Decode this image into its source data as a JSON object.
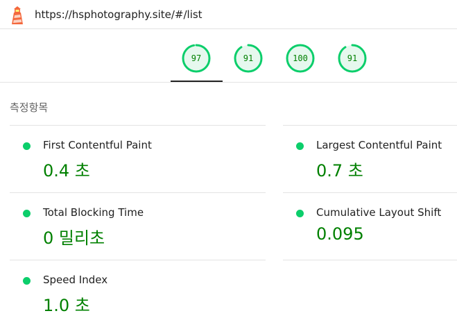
{
  "header": {
    "url": "https://hsphotography.site/#/list"
  },
  "gauges": [
    {
      "score": "97",
      "fraction": 0.97
    },
    {
      "score": "91",
      "fraction": 0.91
    },
    {
      "score": "100",
      "fraction": 1.0
    },
    {
      "score": "91",
      "fraction": 0.91
    }
  ],
  "metrics": {
    "section_title": "측정항목",
    "items": [
      {
        "title": "First Contentful Paint",
        "value": "0.4 초"
      },
      {
        "title": "Largest Contentful Paint",
        "value": "0.7 초"
      },
      {
        "title": "Total Blocking Time",
        "value": "0 밀리초"
      },
      {
        "title": "Cumulative Layout Shift",
        "value": "0.095"
      },
      {
        "title": "Speed Index",
        "value": "1.0 초"
      }
    ]
  },
  "colors": {
    "pass": "#0cce6b",
    "pass_text": "#008000",
    "gauge_fill": "#e6f8ee"
  }
}
